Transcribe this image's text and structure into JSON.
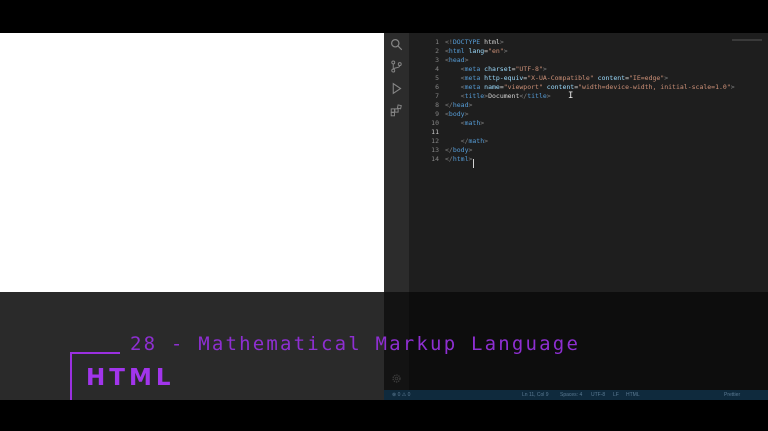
{
  "editor": {
    "lines": [
      {
        "n": "1",
        "segs": [
          [
            "punct",
            "<!"
          ],
          [
            "tag",
            "DOCTYPE"
          ],
          [
            "txt",
            " html"
          ],
          [
            "punct",
            ">"
          ]
        ]
      },
      {
        "n": "2",
        "segs": [
          [
            "punct",
            "<"
          ],
          [
            "tag",
            "html"
          ],
          [
            "txt",
            " "
          ],
          [
            "attr",
            "lang"
          ],
          [
            "txt",
            "="
          ],
          [
            "str",
            "\"en\""
          ],
          [
            "punct",
            ">"
          ]
        ]
      },
      {
        "n": "3",
        "segs": [
          [
            "punct",
            "<"
          ],
          [
            "tag",
            "head"
          ],
          [
            "punct",
            ">"
          ]
        ]
      },
      {
        "n": "4",
        "segs": [
          [
            "txt",
            "    "
          ],
          [
            "punct",
            "<"
          ],
          [
            "tag",
            "meta"
          ],
          [
            "txt",
            " "
          ],
          [
            "attr",
            "charset"
          ],
          [
            "txt",
            "="
          ],
          [
            "str",
            "\"UTF-8\""
          ],
          [
            "punct",
            ">"
          ]
        ]
      },
      {
        "n": "5",
        "segs": [
          [
            "txt",
            "    "
          ],
          [
            "punct",
            "<"
          ],
          [
            "tag",
            "meta"
          ],
          [
            "txt",
            " "
          ],
          [
            "attr",
            "http-equiv"
          ],
          [
            "txt",
            "="
          ],
          [
            "str",
            "\"X-UA-Compatible\""
          ],
          [
            "txt",
            " "
          ],
          [
            "attr",
            "content"
          ],
          [
            "txt",
            "="
          ],
          [
            "str",
            "\"IE=edge\""
          ],
          [
            "punct",
            ">"
          ]
        ]
      },
      {
        "n": "6",
        "segs": [
          [
            "txt",
            "    "
          ],
          [
            "punct",
            "<"
          ],
          [
            "tag",
            "meta"
          ],
          [
            "txt",
            " "
          ],
          [
            "attr",
            "name"
          ],
          [
            "txt",
            "="
          ],
          [
            "str",
            "\"viewport\""
          ],
          [
            "txt",
            " "
          ],
          [
            "attr",
            "content"
          ],
          [
            "txt",
            "="
          ],
          [
            "str",
            "\"width=device-width, initial-scale=1.0\""
          ],
          [
            "punct",
            ">"
          ]
        ]
      },
      {
        "n": "7",
        "segs": [
          [
            "txt",
            "    "
          ],
          [
            "punct",
            "<"
          ],
          [
            "tag",
            "title"
          ],
          [
            "punct",
            ">"
          ],
          [
            "txt",
            "Document"
          ],
          [
            "punct",
            "</"
          ],
          [
            "tag",
            "title"
          ],
          [
            "punct",
            ">"
          ]
        ]
      },
      {
        "n": "8",
        "segs": [
          [
            "punct",
            "</"
          ],
          [
            "tag",
            "head"
          ],
          [
            "punct",
            ">"
          ]
        ]
      },
      {
        "n": "9",
        "segs": [
          [
            "punct",
            "<"
          ],
          [
            "tag",
            "body"
          ],
          [
            "punct",
            ">"
          ]
        ]
      },
      {
        "n": "10",
        "segs": [
          [
            "txt",
            "    "
          ],
          [
            "punct",
            "<"
          ],
          [
            "tag",
            "math"
          ],
          [
            "punct",
            ">"
          ]
        ]
      },
      {
        "n": "11",
        "segs": []
      },
      {
        "n": "12",
        "segs": [
          [
            "txt",
            "    "
          ],
          [
            "punct",
            "</"
          ],
          [
            "tag",
            "math"
          ],
          [
            "punct",
            ">"
          ]
        ]
      },
      {
        "n": "13",
        "segs": [
          [
            "punct",
            "</"
          ],
          [
            "tag",
            "body"
          ],
          [
            "punct",
            ">"
          ]
        ]
      },
      {
        "n": "14",
        "segs": [
          [
            "punct",
            "</"
          ],
          [
            "tag",
            "html"
          ],
          [
            "punct",
            ">"
          ]
        ]
      }
    ],
    "active_line": "11",
    "ibeam_glyph": "I"
  },
  "status_bar": {
    "position": "Ln 11, Col 9",
    "spaces": "Spaces: 4",
    "encoding": "UTF-8",
    "eol": "LF",
    "language": "HTML",
    "formatter": "Prettier",
    "errors": "⊗ 0 ⚠ 0"
  },
  "overlay": {
    "subtitle": "28 - Mathematical Markup Language",
    "badge": "HTML"
  },
  "colors": {
    "accent": "#9b30e0",
    "editor_bg": "#1e1e1e",
    "tag": "#569cd6",
    "attr": "#9cdcfe",
    "string": "#ce9178"
  },
  "icons": [
    "search-icon",
    "source-control-icon",
    "run-debug-icon",
    "extensions-icon",
    "settings-gear-icon"
  ]
}
